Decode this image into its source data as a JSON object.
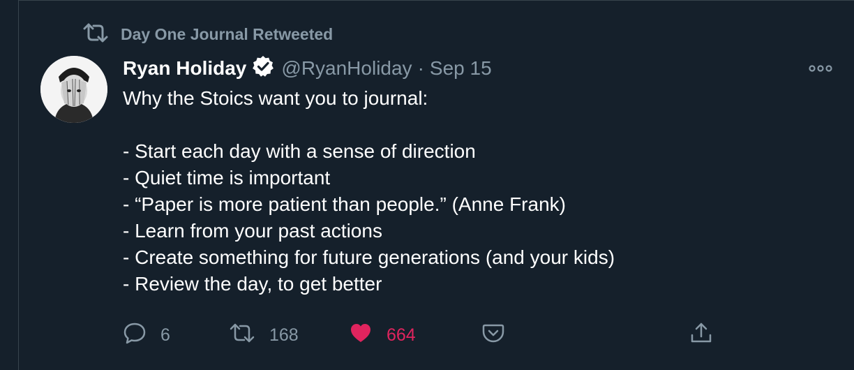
{
  "retweet": {
    "label": "Day One Journal Retweeted",
    "icon": "retweet-icon"
  },
  "tweet": {
    "author_name": "Ryan Holiday",
    "verified": true,
    "handle": "@RyanHoliday",
    "separator": "·",
    "date": "Sep 15",
    "lines": [
      "Why the Stoics want you to journal:",
      "",
      "- Start each day with a sense of direction",
      "- Quiet time is important",
      "- “Paper is more patient than people.” (Anne Frank)",
      "- Learn from your past actions",
      "- Create something for future generations (and your kids)",
      "- Review the day, to get better"
    ]
  },
  "actions": {
    "reply_count": "6",
    "retweet_count": "168",
    "like_count": "664"
  },
  "colors": {
    "background": "#15202b",
    "muted": "#8899a6",
    "like": "#e0245e",
    "border": "#38444d"
  }
}
